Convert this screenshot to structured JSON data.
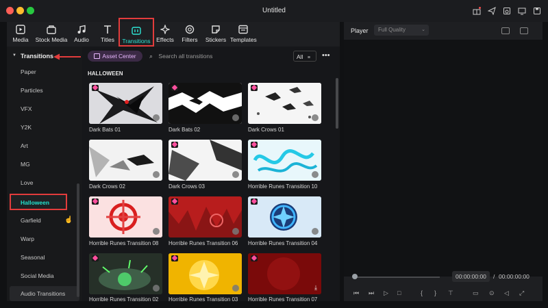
{
  "window": {
    "title": "Untitled",
    "traffic_lights": [
      "#fe5f57",
      "#febc2e",
      "#28c840"
    ],
    "right_icons": [
      "gift-icon",
      "send-icon",
      "save-cloud-icon",
      "monitor-icon",
      "export-icon"
    ]
  },
  "toolbar": {
    "accent": "#2ee6d6",
    "items": [
      {
        "label": "Media",
        "icon": "media-icon"
      },
      {
        "label": "Stock Media",
        "icon": "stock-media-icon"
      },
      {
        "label": "Audio",
        "icon": "music-note-icon"
      },
      {
        "label": "Titles",
        "icon": "titles-t-icon"
      },
      {
        "label": "Transitions",
        "icon": "transitions-icon",
        "active": true
      },
      {
        "label": "Effects",
        "icon": "effects-sparkle-icon"
      },
      {
        "label": "Filters",
        "icon": "filters-icon"
      },
      {
        "label": "Stickers",
        "icon": "sticker-icon"
      },
      {
        "label": "Templates",
        "icon": "templates-icon"
      }
    ]
  },
  "sidebar": {
    "header": "Transitions",
    "items": [
      "Paper",
      "Particles",
      "VFX",
      "Y2K",
      "Art",
      "MG",
      "Love",
      "Halloween",
      "Garfield",
      "Warp",
      "Seasonal",
      "Social Media",
      "Audio Transitions"
    ],
    "selected": "Halloween"
  },
  "content": {
    "asset_center_label": "Asset Center",
    "search_placeholder": "Search all transitions",
    "filter_label": "All",
    "more_label": "•••",
    "section_title": "HALLOWEEN",
    "items": [
      {
        "name": "Dark Bats 01"
      },
      {
        "name": "Dark Bats 02"
      },
      {
        "name": "Dark Crows 01"
      },
      {
        "name": "Dark Crows 02"
      },
      {
        "name": "Dark Crows 03"
      },
      {
        "name": "Horrible Runes Transition 10"
      },
      {
        "name": "Horrible Runes Transition 08"
      },
      {
        "name": "Horrible Runes Transition 06"
      },
      {
        "name": "Horrible Runes Transition 04"
      },
      {
        "name": "Horrible Runes Transition 02"
      },
      {
        "name": "Horrible Runes Transition 03"
      },
      {
        "name": "Horrible Runes Transition 07"
      }
    ]
  },
  "player": {
    "label": "Player",
    "quality": "Full Quality",
    "current_time": "00:00:00:00",
    "separator": "/",
    "total_time": "00:00:00:00"
  }
}
